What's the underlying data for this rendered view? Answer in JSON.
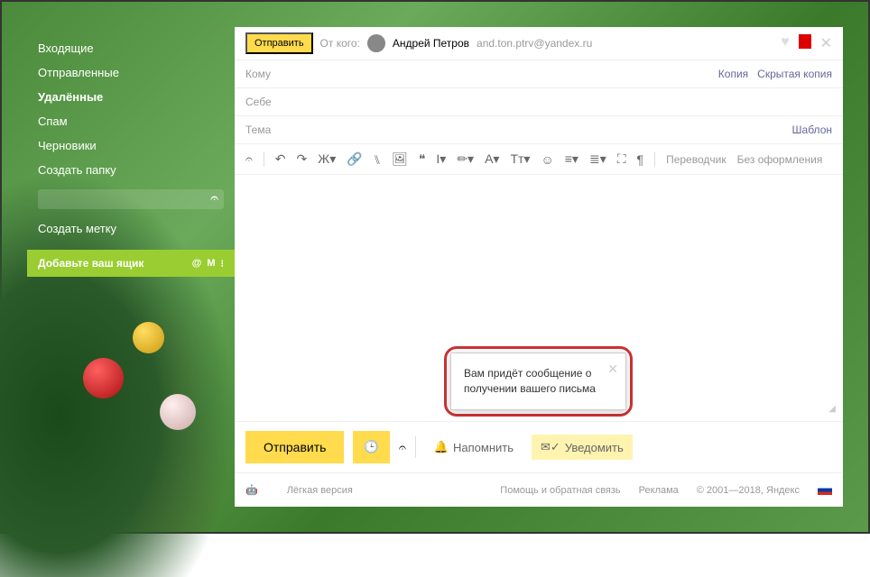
{
  "sidebar": {
    "folders": [
      {
        "label": "Входящие"
      },
      {
        "label": "Отправленные"
      },
      {
        "label": "Удалённые"
      },
      {
        "label": "Спам"
      },
      {
        "label": "Черновики"
      },
      {
        "label": "Создать папку"
      }
    ],
    "create_label": "Создать метку",
    "add_mailbox": "Добавьте ваш ящик"
  },
  "topbar": {
    "send": "Отправить",
    "from_label": "От кого:",
    "from_name": "Андрей Петров",
    "from_email": "and.ton.ptrv@yandex.ru"
  },
  "fields": {
    "to": "Кому",
    "cc": "Копия",
    "bcc": "Скрытая копия",
    "self": "Себе",
    "subject": "Тема",
    "template": "Шаблон"
  },
  "toolbar": {
    "translator": "Переводчик",
    "no_format": "Без оформления"
  },
  "bottom": {
    "send": "Отправить",
    "remind": "Напомнить",
    "notify": "Уведомить"
  },
  "tooltip": {
    "text": "Вам придёт сообщение о получении вашего письма"
  },
  "footer": {
    "lite": "Лёгкая версия",
    "help": "Помощь и обратная связь",
    "ads": "Реклама",
    "copyright": "© 2001—2018, Яндекс"
  }
}
